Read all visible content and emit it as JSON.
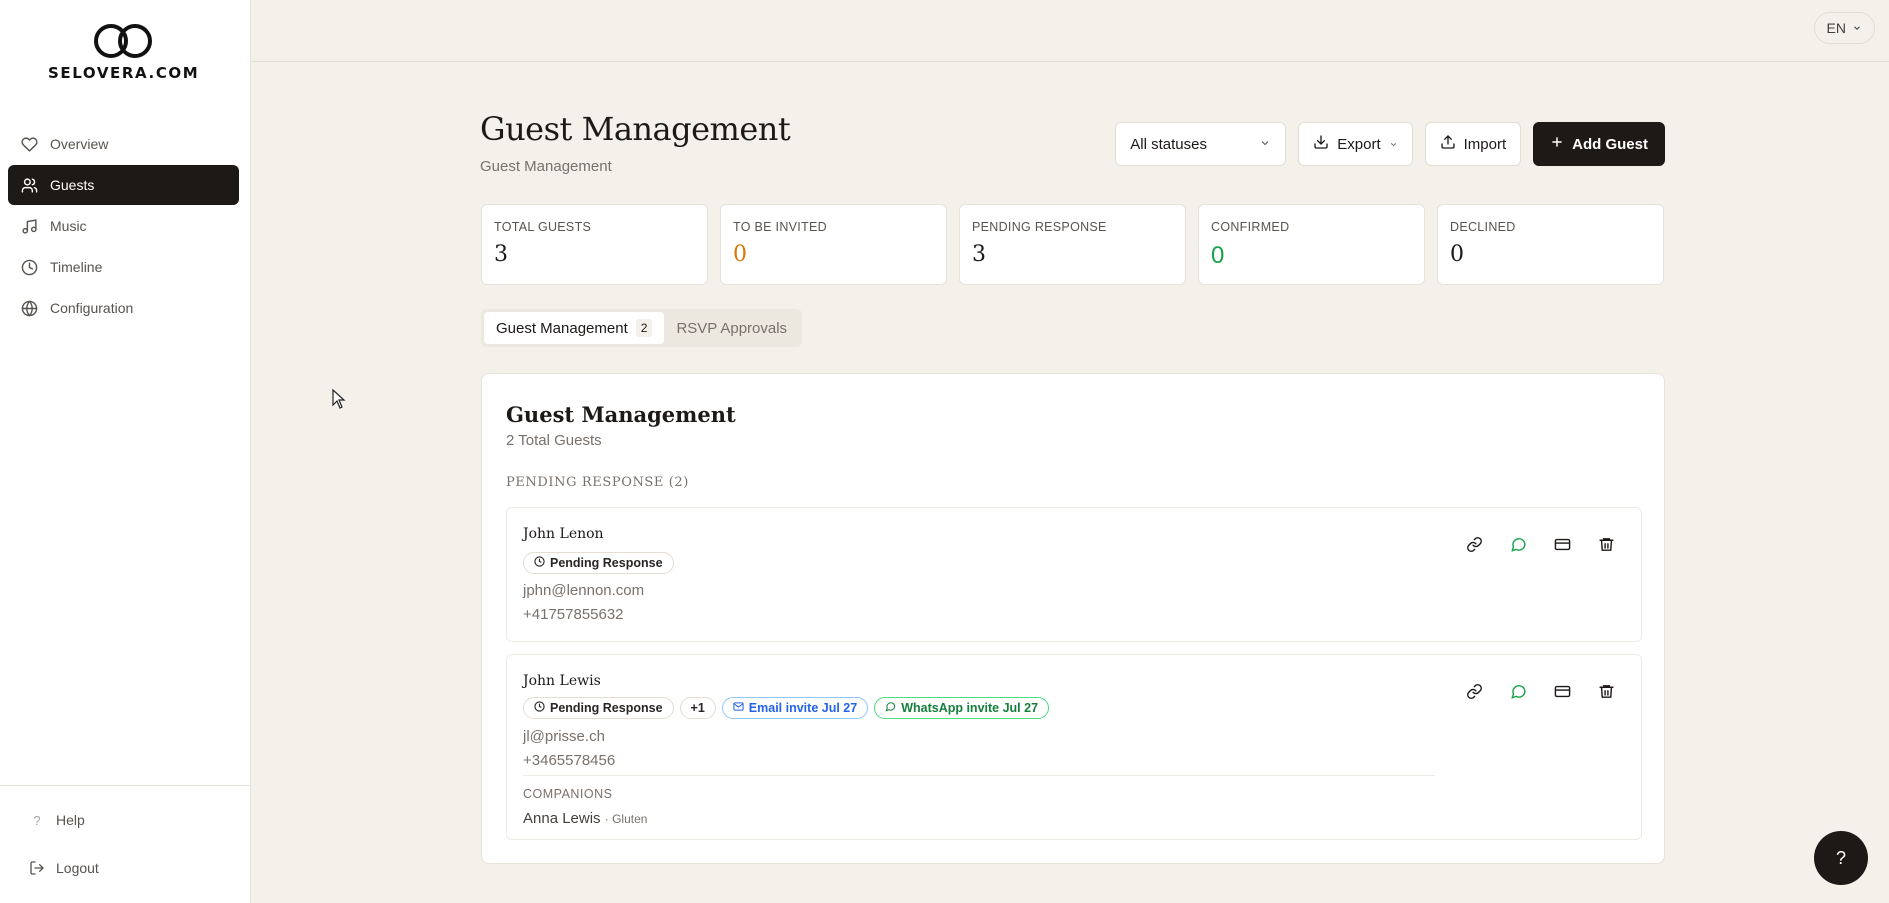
{
  "brand": {
    "logo_text": "SELOVERA.COM"
  },
  "sidebar": {
    "items": [
      {
        "label": "Overview",
        "icon": "heart-icon"
      },
      {
        "label": "Guests",
        "icon": "users-icon"
      },
      {
        "label": "Music",
        "icon": "music-icon"
      },
      {
        "label": "Timeline",
        "icon": "clock-icon"
      },
      {
        "label": "Configuration",
        "icon": "globe-icon"
      }
    ],
    "help_label": "Help",
    "logout_label": "Logout"
  },
  "topbar": {
    "language": "EN"
  },
  "header": {
    "title": "Guest Management",
    "subtitle": "Guest Management"
  },
  "toolbar": {
    "status_filter": "All statuses",
    "export_label": "Export",
    "import_label": "Import",
    "add_guest_label": "Add Guest"
  },
  "stats": [
    {
      "label": "TOTAL GUESTS",
      "value": "3",
      "color": "#1c1917"
    },
    {
      "label": "TO BE INVITED",
      "value": "0",
      "color": "#d97706"
    },
    {
      "label": "PENDING RESPONSE",
      "value": "3",
      "color": "#1c1917"
    },
    {
      "label": "CONFIRMED",
      "value": "0",
      "color": "#16a34a"
    },
    {
      "label": "DECLINED",
      "value": "0",
      "color": "#1c1917"
    }
  ],
  "tabs": [
    {
      "label": "Guest Management",
      "count": "2"
    },
    {
      "label": "RSVP Approvals"
    }
  ],
  "panel": {
    "title": "Guest Management",
    "subtitle": "2 Total Guests",
    "section_label": "PENDING RESPONSE (2)"
  },
  "guests": [
    {
      "name": "John Lenon",
      "status": "Pending Response",
      "email": "jphn@lennon.com",
      "phone": "+41757855632"
    },
    {
      "name": "John Lewis",
      "status": "Pending Response",
      "plus": "+1",
      "email_invite": "Email invite Jul 27",
      "whatsapp_invite": "WhatsApp invite Jul 27",
      "email": "jl@prisse.ch",
      "phone": "+3465578456",
      "companions_label": "COMPANIONS",
      "companion_name": "Anna Lewis",
      "companion_diet": "· Gluten"
    }
  ],
  "help_fab": "?"
}
